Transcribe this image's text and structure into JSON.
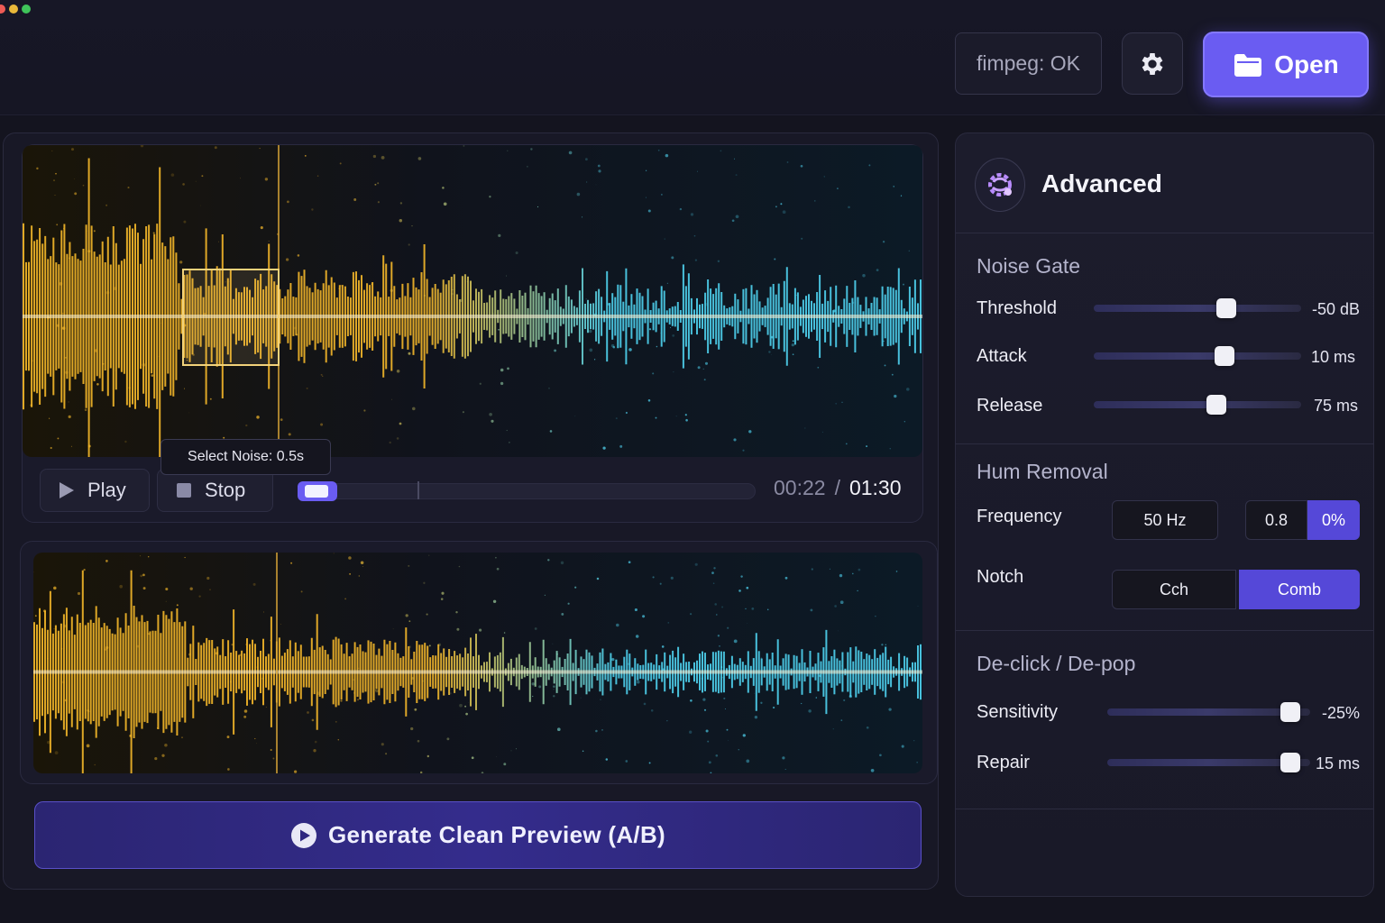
{
  "window": {
    "status_text": "fimpeg: OK",
    "open_label": "Open",
    "accent_color": "#6a5cf2"
  },
  "transport": {
    "play_label": "Play",
    "stop_label": "Stop",
    "tooltip": "Select Noise: 0.5s",
    "current_time": "00:22",
    "separator": "/",
    "total_time": "01:30",
    "progress": 0.04
  },
  "generate": {
    "label": "Generate Clean Preview (A/B)"
  },
  "advanced": {
    "title": "Advanced",
    "noise_gate": {
      "title": "Noise Gate",
      "params": [
        {
          "label": "Threshold",
          "value": "-50 dB",
          "level": 0.64
        },
        {
          "label": "Attack",
          "value": "10 ms",
          "level": 0.63
        },
        {
          "label": "Release",
          "value": "75 ms",
          "level": 0.59
        }
      ]
    },
    "hum_removal": {
      "title": "Hum Removal",
      "frequency_label": "Frequency",
      "frequency_value": "50 Hz",
      "depth_option_a": "0.8",
      "depth_option_b": "0%",
      "notch_label": "Notch",
      "notch_option_a": "Cch",
      "notch_option_b": "Comb"
    },
    "declick": {
      "title": "De-click / De-pop",
      "params": [
        {
          "label": "Sensitivity",
          "value": "-25%",
          "level": 0.9
        },
        {
          "label": "Repair",
          "value": "15 ms",
          "level": 0.9
        }
      ]
    }
  },
  "icons": {
    "gear": "gear-icon",
    "open": "folder-icon",
    "play": "play-icon",
    "stop": "stop-icon",
    "generate": "play-circle-icon",
    "advanced": "settings-brain-icon"
  },
  "colors": {
    "wave_warm": "#f5b82a",
    "wave_cool": "#4fd3f0"
  }
}
